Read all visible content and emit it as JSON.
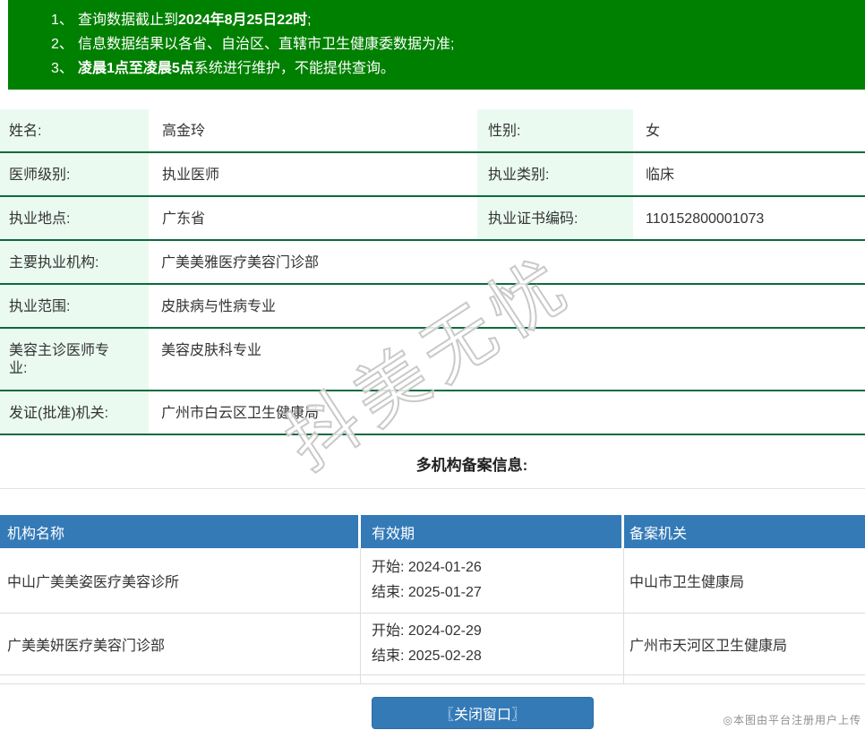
{
  "notice": {
    "items": [
      {
        "num": "1、",
        "pre": "查询数据截止到",
        "bold": "2024年8月25日22时",
        "post": ";"
      },
      {
        "num": "2、",
        "pre": "信息数据结果以各省、自治区、直辖市卫生健康委数据为准;",
        "bold": "",
        "post": ""
      },
      {
        "num": "3、",
        "pre": "",
        "bold": "凌晨1点至凌晨5点",
        "post": "系统进行维护，不能提供查询。"
      }
    ]
  },
  "info": {
    "rows": [
      {
        "l1": "姓名:",
        "v1": "高金玲",
        "l2": "性别:",
        "v2": "女"
      },
      {
        "l1": "医师级别:",
        "v1": "执业医师",
        "l2": "执业类别:",
        "v2": "临床"
      },
      {
        "l1": "执业地点:",
        "v1": "广东省",
        "l2": "执业证书编码:",
        "v2": "110152800001073"
      },
      {
        "l1": "主要执业机构:",
        "v1": "广美美雅医疗美容门诊部"
      },
      {
        "l1": "执业范围:",
        "v1": "皮肤病与性病专业"
      },
      {
        "l1": "美容主诊医师专业:",
        "v1": "美容皮肤科专业"
      },
      {
        "l1": "发证(批准)机关:",
        "v1": "广州市白云区卫生健康局"
      }
    ]
  },
  "filing": {
    "title": "多机构备案信息:",
    "headers": [
      "机构名称",
      "有效期",
      "备案机关"
    ],
    "rows": [
      {
        "name": "中山广美美姿医疗美容诊所",
        "start": "开始: 2024-01-26",
        "end": "结束: 2025-01-27",
        "authority": "中山市卫生健康局"
      },
      {
        "name": "广美美妍医疗美容门诊部",
        "start": "开始: 2024-02-29",
        "end": "结束: 2025-02-28",
        "authority": "广州市天河区卫生健康局"
      }
    ]
  },
  "button": {
    "close_label": "〖关闭窗口〗"
  },
  "watermark": {
    "text": "抖美无忧"
  },
  "credit": "◎本图由平台注册用户上传",
  "colors": {
    "banner_green": "#008000",
    "row_border_green": "#0c6b3d",
    "label_bg": "#eafaf1",
    "header_blue": "#337ab7",
    "button_blue": "#337ab7"
  }
}
